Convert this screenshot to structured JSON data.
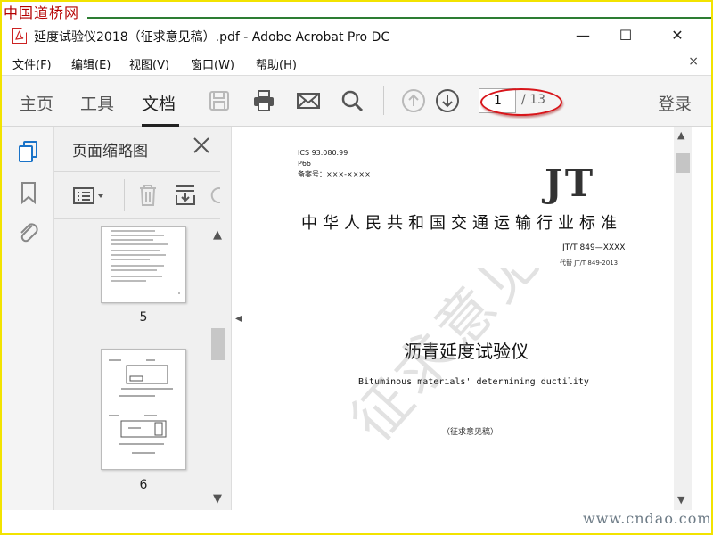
{
  "watermarks": {
    "top": "中国道桥网",
    "bottom": "www.cndao.com"
  },
  "window": {
    "title": "延度试验仪2018（征求意见稿）.pdf - Adobe Acrobat Pro DC",
    "controls": {
      "minimize": "—",
      "maximize": "☐",
      "close": "✕"
    }
  },
  "menu": {
    "items": [
      "文件(F)",
      "编辑(E)",
      "视图(V)",
      "窗口(W)",
      "帮助(H)"
    ],
    "close": "×"
  },
  "toolbar": {
    "tabs": [
      "主页",
      "工具",
      "文档"
    ],
    "active_tab": "文档",
    "icons": [
      "save-icon",
      "print-icon",
      "mail-icon",
      "search-icon",
      "page-up-icon",
      "page-down-icon"
    ],
    "current_page": "1",
    "total_pages": "/ 13",
    "login": "登录",
    "annotation_color": "#d8161b"
  },
  "left_rail": {
    "icons": [
      "pages-icon",
      "bookmark-icon",
      "attachment-icon"
    ],
    "accent": "#1a73c8"
  },
  "thumbnail_panel": {
    "title": "页面缩略图",
    "close": "✕",
    "tools": [
      "options-menu-icon",
      "delete-icon",
      "extract-icon"
    ],
    "pages": [
      {
        "label": "5"
      },
      {
        "label": "6"
      }
    ],
    "scroll_up": "▲",
    "scroll_down": "▼"
  },
  "document": {
    "ics": "ICS  93.080.99",
    "classification": "P66",
    "record_no": "备案号：×××-××××",
    "logo": "JT",
    "standard_title": "中华人民共和国交通运输行业标准",
    "code": "JT/T 849—XXXX",
    "replaces": "代替 JT/T 849-2013",
    "cn_title": "沥青延度试验仪",
    "en_title": "Bituminous materials'  determining ductility",
    "draft_note": "（征求意见稿）",
    "watermark": "征求意见稿"
  },
  "scrollbar": {
    "up": "▲",
    "down": "▼"
  },
  "collapse_tab": "◀"
}
